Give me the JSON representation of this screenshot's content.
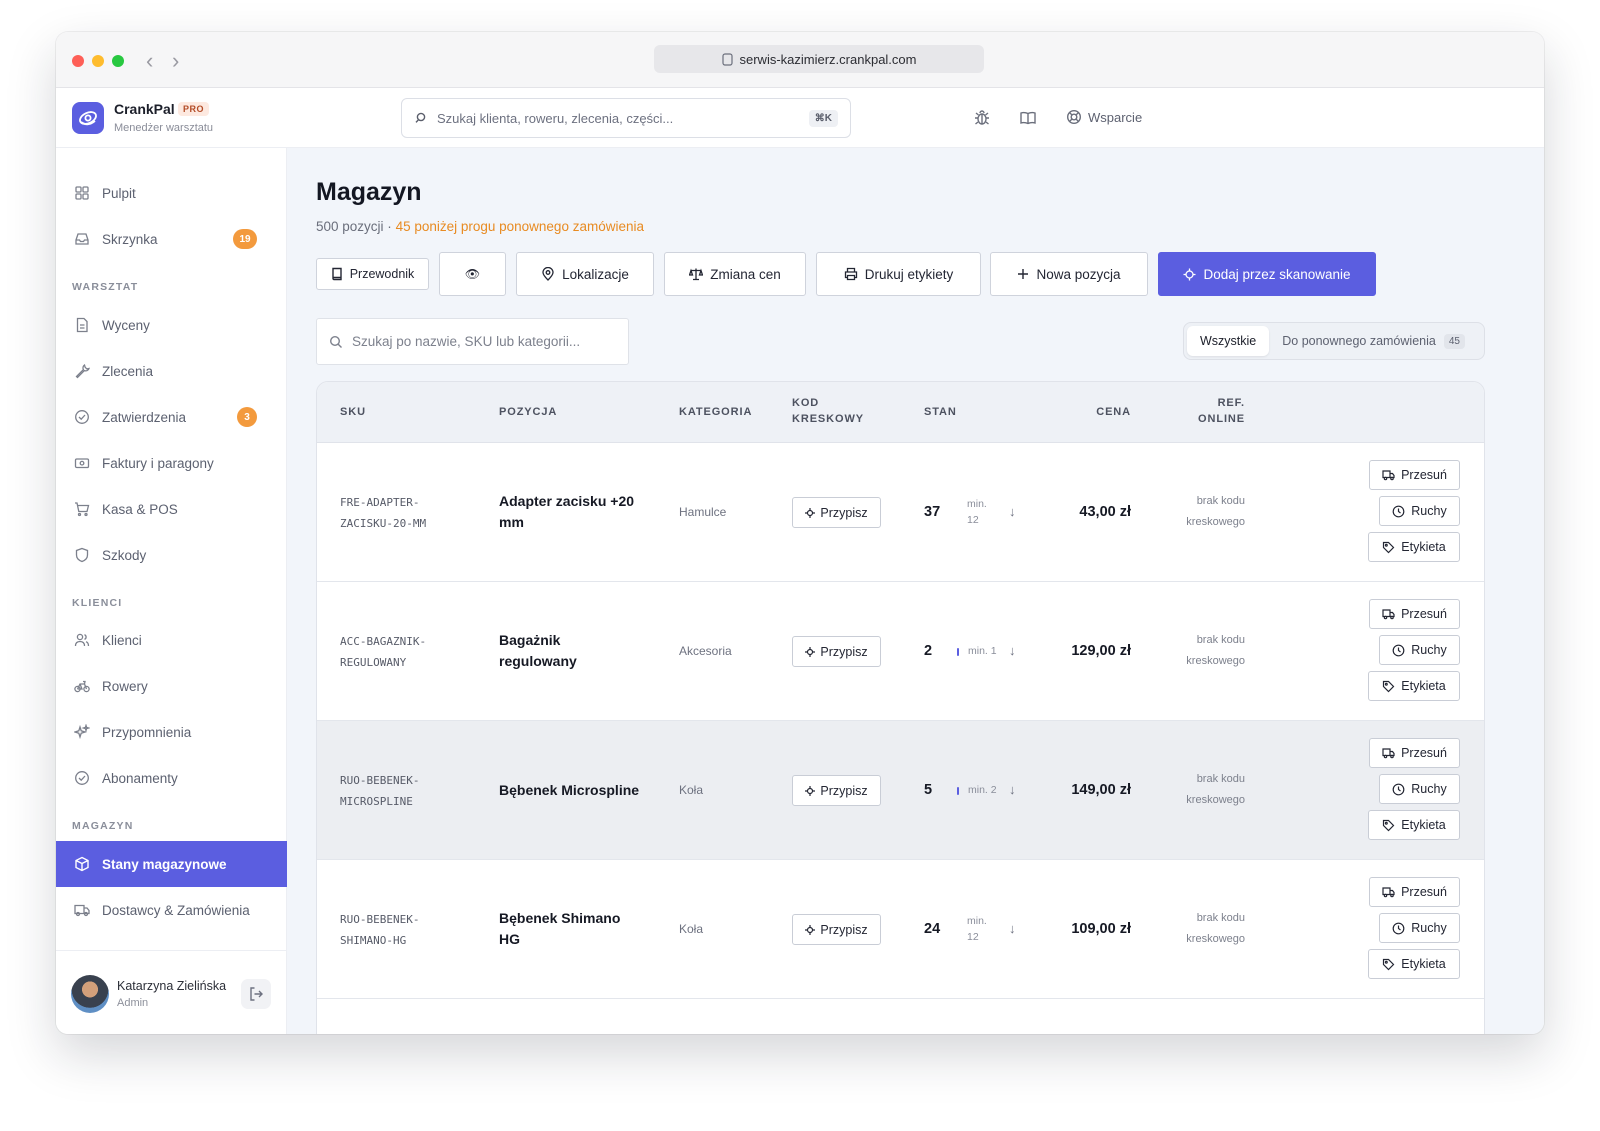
{
  "browser": {
    "url": "serwis-kazimierz.crankpal.com"
  },
  "brand": {
    "name": "CrankPal",
    "badge": "PRO",
    "subtitle": "Menedżer warsztatu"
  },
  "header": {
    "search_placeholder": "Szukaj klienta, roweru, zlecenia, części...",
    "shortcut": "⌘K",
    "support_label": "Wsparcie"
  },
  "sidebar": {
    "dashboard": "Pulpit",
    "inbox": {
      "label": "Skrzynka",
      "badge": "19"
    },
    "section_workshop": "WARSZTAT",
    "quotes": "Wyceny",
    "orders": "Zlecenia",
    "approvals": {
      "label": "Zatwierdzenia",
      "badge": "3"
    },
    "invoices": "Faktury i paragony",
    "pos": "Kasa & POS",
    "damages": "Szkody",
    "section_clients": "KLIENCI",
    "clients": "Klienci",
    "bikes": "Rowery",
    "reminders": "Przypomnienia",
    "subscriptions": "Abonamenty",
    "section_warehouse": "MAGAZYN",
    "stock": "Stany magazynowe",
    "suppliers": "Dostawcy & Zamówienia"
  },
  "user": {
    "name": "Katarzyna Zielińska",
    "role": "Admin"
  },
  "page": {
    "title": "Magazyn",
    "count": "500 pozycji ·",
    "warning": "45 poniżej progu ponownego zamówienia"
  },
  "toolbar": {
    "guide": "Przewodnik",
    "eye": "👁",
    "locations": "Lokalizacje",
    "price_change": "Zmiana cen",
    "print_labels": "Drukuj etykiety",
    "new_item": "Nowa pozycja",
    "add_scan": "Dodaj przez skanowanie"
  },
  "filter": {
    "search_placeholder": "Szukaj po nazwie, SKU lub kategorii...",
    "all": "Wszystkie",
    "reorder": "Do ponownego zamówienia",
    "reorder_count": "45"
  },
  "table": {
    "headers": {
      "sku": "SKU",
      "item": "POZYCJA",
      "category": "KATEGORIA",
      "barcode_1": "KOD",
      "barcode_2": "KRESKOWY",
      "stock": "STAN",
      "price": "CENA",
      "ref_1": "REF.",
      "ref_2": "ONLINE"
    },
    "assign_label": "Przypisz",
    "actions": {
      "move": "Przesuń",
      "movements": "Ruchy",
      "label": "Etykieta"
    },
    "rows": [
      {
        "sku_1": "FRE-ADAPTER-",
        "sku_2": "ZACISKU-20-MM",
        "name_1": "Adapter zacisku +20",
        "name_2": "mm",
        "category": "Hamulce",
        "stock": "37",
        "min_1": "min.",
        "min_2": "12",
        "price": "43,00 zł",
        "ref_1": "brak kodu",
        "ref_2": "kreskowego"
      },
      {
        "sku_1": "ACC-BAGAZNIK-",
        "sku_2": "REGULOWANY",
        "name_1": "Bagażnik",
        "name_2": "regulowany",
        "category": "Akcesoria",
        "stock": "2",
        "min_1": "min. 1",
        "min_2": "",
        "price": "129,00 zł",
        "ref_1": "brak kodu",
        "ref_2": "kreskowego"
      },
      {
        "sku_1": "RUO-BEBENEK-",
        "sku_2": "MICROSPLINE",
        "name_1": "Bębenek Microspline",
        "name_2": "",
        "category": "Koła",
        "stock": "5",
        "min_1": "min. 2",
        "min_2": "",
        "price": "149,00 zł",
        "ref_1": "brak kodu",
        "ref_2": "kreskowego"
      },
      {
        "sku_1": "RUO-BEBENEK-",
        "sku_2": "SHIMANO-HG",
        "name_1": "Bębenek Shimano",
        "name_2": "HG",
        "category": "Koła",
        "stock": "24",
        "min_1": "min.",
        "min_2": "12",
        "price": "109,00 zł",
        "ref_1": "brak kodu",
        "ref_2": "kreskowego"
      }
    ]
  },
  "colors": {
    "accent": "#5b5ee0",
    "warning": "#e88b22",
    "badge": "#f39a3d"
  }
}
